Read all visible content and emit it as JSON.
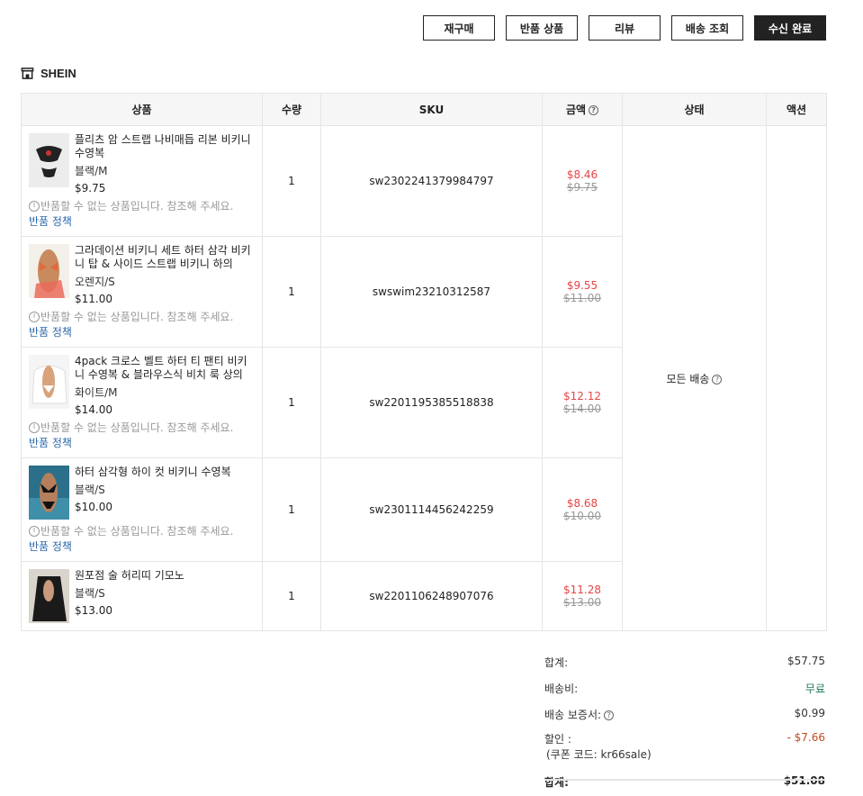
{
  "actions": {
    "repurchase": "재구매",
    "return_items": "반품 상품",
    "review": "리뷰",
    "track": "배송 조회",
    "confirm": "수신 완료"
  },
  "store": {
    "name": "SHEIN"
  },
  "table": {
    "headers": {
      "product": "상품",
      "qty": "수량",
      "sku": "SKU",
      "amount": "금액",
      "status": "상태",
      "action": "액션"
    },
    "status_text": "모든 배송",
    "rows": [
      {
        "name": "플리츠 암 스트랩 나비매듭 리본 비키니 수영복",
        "variant": "블랙/M",
        "price": "$9.75",
        "note": "반품할 수 없는 상품입니다. 참조해 주세요.",
        "policy": "반품 정책",
        "qty": "1",
        "sku": "sw2302241379984797",
        "amount": "$8.46",
        "original": "$9.75"
      },
      {
        "name": "그라데이션 비키니 세트 하터 삼각 비키니 탑 & 사이드 스트랩 비키니 하의",
        "variant": "오렌지/S",
        "price": "$11.00",
        "note": "반품할 수 없는 상품입니다. 참조해 주세요.",
        "policy": "반품 정책",
        "qty": "1",
        "sku": "swswim23210312587",
        "amount": "$9.55",
        "original": "$11.00"
      },
      {
        "name": "4pack 크로스 벨트 하터 티 팬티 비키니 수영복 & 블라우스식 비치 룩 상의",
        "variant": "화이트/M",
        "price": "$14.00",
        "note": "반품할 수 없는 상품입니다. 참조해 주세요.",
        "policy": "반품 정책",
        "qty": "1",
        "sku": "sw2201195385518838",
        "amount": "$12.12",
        "original": "$14.00"
      },
      {
        "name": "하터 삼각형 하이 컷 비키니 수영복",
        "variant": "블랙/S",
        "price": "$10.00",
        "note": "반품할 수 없는 상품입니다. 참조해 주세요.",
        "policy": "반품 정책",
        "qty": "1",
        "sku": "sw2301114456242259",
        "amount": "$8.68",
        "original": "$10.00"
      },
      {
        "name": "원포점 술 허리띠 기모노",
        "variant": "블랙/S",
        "price": "$13.00",
        "qty": "1",
        "sku": "sw2201106248907076",
        "amount": "$11.28",
        "original": "$13.00"
      }
    ]
  },
  "summary": {
    "subtotal_label": "합계:",
    "subtotal": "$57.75",
    "shipping_label": "배송비:",
    "shipping": "무료",
    "insurance_label": "배송 보증서:",
    "insurance": "$0.99",
    "discount_label": "할인 :",
    "coupon": "(쿠폰 코드: kr66sale)",
    "discount": "- $7.66",
    "total_label": "합계:",
    "total": "$51.08"
  },
  "colors": {
    "sale": "#e64545",
    "free": "#1e7a55",
    "discount": "#c44a1f",
    "link": "#2d68a8"
  }
}
